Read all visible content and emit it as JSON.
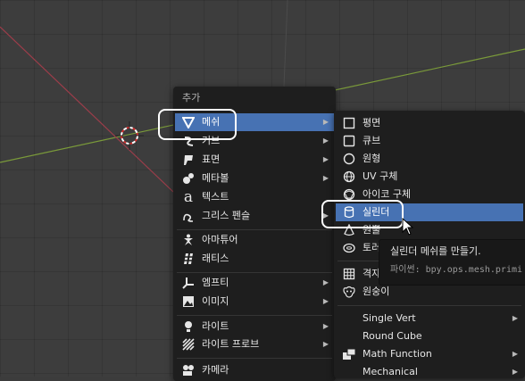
{
  "add_menu": {
    "title": "추가",
    "items": [
      {
        "label": "메쉬",
        "icon": "mesh-cone-icon",
        "submenu": true,
        "active": true
      },
      {
        "label": "커브",
        "icon": "curve-icon",
        "submenu": true
      },
      {
        "label": "표면",
        "icon": "surface-icon",
        "submenu": true
      },
      {
        "label": "메타볼",
        "icon": "metaball-icon",
        "submenu": true
      },
      {
        "label": "텍스트",
        "icon": "text-icon",
        "submenu": false
      },
      {
        "label": "그리스 펜슬",
        "icon": "grease-pencil-icon",
        "submenu": true
      },
      {
        "label": "아마튜어",
        "icon": "armature-icon",
        "submenu": false
      },
      {
        "label": "래티스",
        "icon": "lattice-icon",
        "submenu": false
      },
      {
        "label": "엠프티",
        "icon": "empty-icon",
        "submenu": true
      },
      {
        "label": "이미지",
        "icon": "image-icon",
        "submenu": true
      },
      {
        "label": "라이트",
        "icon": "light-icon",
        "submenu": true
      },
      {
        "label": "라이트 프로브",
        "icon": "light-probe-icon",
        "submenu": true
      },
      {
        "label": "카메라",
        "icon": "camera-icon",
        "submenu": false
      }
    ]
  },
  "mesh_menu": {
    "items": [
      {
        "label": "평면",
        "icon": "plane-icon"
      },
      {
        "label": "큐브",
        "icon": "cube-icon"
      },
      {
        "label": "원형",
        "icon": "circle-icon"
      },
      {
        "label": "UV 구체",
        "icon": "uv-sphere-icon"
      },
      {
        "label": "아이코 구체",
        "icon": "ico-sphere-icon"
      },
      {
        "label": "실린더",
        "icon": "cylinder-icon",
        "active": true
      },
      {
        "label": "원뿔",
        "icon": "cone-icon"
      },
      {
        "label": "토러스",
        "icon": "torus-icon"
      },
      {
        "label": "격자",
        "icon": "grid-icon"
      },
      {
        "label": "원숭이",
        "icon": "monkey-icon"
      },
      {
        "label": "Single Vert",
        "icon": "",
        "submenu": true
      },
      {
        "label": "Round Cube",
        "icon": ""
      },
      {
        "label": "Math Function",
        "icon": "math-function-icon",
        "submenu": true
      },
      {
        "label": "Mechanical",
        "icon": "",
        "submenu": true
      }
    ]
  },
  "tooltip": {
    "description": "실린더 메쉬를 만들기.",
    "python": "파이썬: bpy.ops.mesh.primi"
  },
  "colors": {
    "menu_bg": "#1e1e1e",
    "highlight": "#4772b3",
    "viewport_bg": "#3d3d3d",
    "x_axis": "#9c3d4a",
    "y_axis": "#7a9a3a"
  }
}
